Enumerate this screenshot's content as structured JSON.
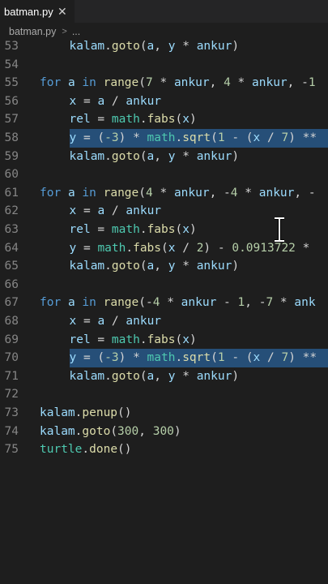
{
  "tab": {
    "label": "batman.py",
    "close_glyph": "✕"
  },
  "breadcrumb": {
    "file": "batman.py",
    "more": "..."
  },
  "colors": {
    "keyword": "#569cd6",
    "module": "#4ec9b0",
    "variable": "#9cdcfe",
    "function": "#dcdcaa",
    "number": "#b5cea8",
    "operator": "#d4d4d4",
    "selection": "#264f78",
    "line_number": "#858585"
  },
  "code": [
    {
      "n": "53",
      "indent": 1,
      "tokens": [
        [
          "kalam",
          "t"
        ],
        [
          ".",
          "o"
        ],
        [
          "goto",
          "f"
        ],
        [
          "(",
          "o"
        ],
        [
          "a",
          "t"
        ],
        [
          ", ",
          "o"
        ],
        [
          "y",
          "t"
        ],
        [
          " * ",
          "o"
        ],
        [
          "ankur",
          "t"
        ],
        [
          ")",
          "o"
        ]
      ]
    },
    {
      "n": "54",
      "indent": 0,
      "tokens": []
    },
    {
      "n": "55",
      "indent": 0,
      "tokens": [
        [
          "for",
          "k"
        ],
        [
          " ",
          "o"
        ],
        [
          "a",
          "t"
        ],
        [
          " ",
          "o"
        ],
        [
          "in",
          "k"
        ],
        [
          " ",
          "o"
        ],
        [
          "range",
          "f"
        ],
        [
          "(",
          "o"
        ],
        [
          "7",
          "n"
        ],
        [
          " * ",
          "o"
        ],
        [
          "ankur",
          "t"
        ],
        [
          ", ",
          "o"
        ],
        [
          "4",
          "n"
        ],
        [
          " * ",
          "o"
        ],
        [
          "ankur",
          "t"
        ],
        [
          ", -",
          "o"
        ],
        [
          "1",
          "n"
        ]
      ]
    },
    {
      "n": "56",
      "indent": 1,
      "tokens": [
        [
          "x",
          "t"
        ],
        [
          " = ",
          "o"
        ],
        [
          "a",
          "t"
        ],
        [
          " / ",
          "o"
        ],
        [
          "ankur",
          "t"
        ]
      ]
    },
    {
      "n": "57",
      "indent": 1,
      "tokens": [
        [
          "rel",
          "t"
        ],
        [
          " = ",
          "o"
        ],
        [
          "math",
          "g"
        ],
        [
          ".",
          "o"
        ],
        [
          "fabs",
          "f"
        ],
        [
          "(",
          "o"
        ],
        [
          "x",
          "t"
        ],
        [
          ")",
          "o"
        ]
      ]
    },
    {
      "n": "58",
      "indent": 1,
      "selected": true,
      "tokens": [
        [
          "y",
          "t"
        ],
        [
          " = (",
          "o"
        ],
        [
          "-3",
          "n"
        ],
        [
          ") * ",
          "o"
        ],
        [
          "math",
          "g"
        ],
        [
          ".",
          "o"
        ],
        [
          "sqrt",
          "f"
        ],
        [
          "(",
          "o"
        ],
        [
          "1",
          "n"
        ],
        [
          " - (",
          "o"
        ],
        [
          "x",
          "t"
        ],
        [
          " / ",
          "o"
        ],
        [
          "7",
          "n"
        ],
        [
          ") **",
          "o"
        ]
      ]
    },
    {
      "n": "59",
      "indent": 1,
      "tokens": [
        [
          "kalam",
          "t"
        ],
        [
          ".",
          "o"
        ],
        [
          "goto",
          "f"
        ],
        [
          "(",
          "o"
        ],
        [
          "a",
          "t"
        ],
        [
          ", ",
          "o"
        ],
        [
          "y",
          "t"
        ],
        [
          " * ",
          "o"
        ],
        [
          "ankur",
          "t"
        ],
        [
          ")",
          "o"
        ]
      ]
    },
    {
      "n": "60",
      "indent": 0,
      "tokens": []
    },
    {
      "n": "61",
      "indent": 0,
      "tokens": [
        [
          "for",
          "k"
        ],
        [
          " ",
          "o"
        ],
        [
          "a",
          "t"
        ],
        [
          " ",
          "o"
        ],
        [
          "in",
          "k"
        ],
        [
          " ",
          "o"
        ],
        [
          "range",
          "f"
        ],
        [
          "(",
          "o"
        ],
        [
          "4",
          "n"
        ],
        [
          " * ",
          "o"
        ],
        [
          "ankur",
          "t"
        ],
        [
          ", -",
          "o"
        ],
        [
          "4",
          "n"
        ],
        [
          " * ",
          "o"
        ],
        [
          "ankur",
          "t"
        ],
        [
          ", -",
          "o"
        ]
      ]
    },
    {
      "n": "62",
      "indent": 1,
      "tokens": [
        [
          "x",
          "t"
        ],
        [
          " = ",
          "o"
        ],
        [
          "a",
          "t"
        ],
        [
          " / ",
          "o"
        ],
        [
          "ankur",
          "t"
        ]
      ]
    },
    {
      "n": "63",
      "indent": 1,
      "tokens": [
        [
          "rel",
          "t"
        ],
        [
          " = ",
          "o"
        ],
        [
          "math",
          "g"
        ],
        [
          ".",
          "o"
        ],
        [
          "fabs",
          "f"
        ],
        [
          "(",
          "o"
        ],
        [
          "x",
          "t"
        ],
        [
          ")",
          "o"
        ]
      ]
    },
    {
      "n": "64",
      "indent": 1,
      "tokens": [
        [
          "y",
          "t"
        ],
        [
          " = ",
          "o"
        ],
        [
          "math",
          "g"
        ],
        [
          ".",
          "o"
        ],
        [
          "fabs",
          "f"
        ],
        [
          "(",
          "o"
        ],
        [
          "x",
          "t"
        ],
        [
          " / ",
          "o"
        ],
        [
          "2",
          "n"
        ],
        [
          ") - ",
          "o"
        ],
        [
          "0.0913722",
          "n"
        ],
        [
          " *",
          "o"
        ]
      ]
    },
    {
      "n": "65",
      "indent": 1,
      "tokens": [
        [
          "kalam",
          "t"
        ],
        [
          ".",
          "o"
        ],
        [
          "goto",
          "f"
        ],
        [
          "(",
          "o"
        ],
        [
          "a",
          "t"
        ],
        [
          ", ",
          "o"
        ],
        [
          "y",
          "t"
        ],
        [
          " * ",
          "o"
        ],
        [
          "ankur",
          "t"
        ],
        [
          ")",
          "o"
        ]
      ]
    },
    {
      "n": "66",
      "indent": 0,
      "tokens": []
    },
    {
      "n": "67",
      "indent": 0,
      "tokens": [
        [
          "for",
          "k"
        ],
        [
          " ",
          "o"
        ],
        [
          "a",
          "t"
        ],
        [
          " ",
          "o"
        ],
        [
          "in",
          "k"
        ],
        [
          " ",
          "o"
        ],
        [
          "range",
          "f"
        ],
        [
          "(-",
          "o"
        ],
        [
          "4",
          "n"
        ],
        [
          " * ",
          "o"
        ],
        [
          "ankur",
          "t"
        ],
        [
          " - ",
          "o"
        ],
        [
          "1",
          "n"
        ],
        [
          ", -",
          "o"
        ],
        [
          "7",
          "n"
        ],
        [
          " * ",
          "o"
        ],
        [
          "ank",
          "t"
        ]
      ]
    },
    {
      "n": "68",
      "indent": 1,
      "tokens": [
        [
          "x",
          "t"
        ],
        [
          " = ",
          "o"
        ],
        [
          "a",
          "t"
        ],
        [
          " / ",
          "o"
        ],
        [
          "ankur",
          "t"
        ]
      ]
    },
    {
      "n": "69",
      "indent": 1,
      "tokens": [
        [
          "rel",
          "t"
        ],
        [
          " = ",
          "o"
        ],
        [
          "math",
          "g"
        ],
        [
          ".",
          "o"
        ],
        [
          "fabs",
          "f"
        ],
        [
          "(",
          "o"
        ],
        [
          "x",
          "t"
        ],
        [
          ")",
          "o"
        ]
      ]
    },
    {
      "n": "70",
      "indent": 1,
      "selected": true,
      "tokens": [
        [
          "y",
          "t"
        ],
        [
          " = (",
          "o"
        ],
        [
          "-3",
          "n"
        ],
        [
          ") * ",
          "o"
        ],
        [
          "math",
          "g"
        ],
        [
          ".",
          "o"
        ],
        [
          "sqrt",
          "f"
        ],
        [
          "(",
          "o"
        ],
        [
          "1",
          "n"
        ],
        [
          " - (",
          "o"
        ],
        [
          "x",
          "t"
        ],
        [
          " / ",
          "o"
        ],
        [
          "7",
          "n"
        ],
        [
          ") **",
          "o"
        ]
      ]
    },
    {
      "n": "71",
      "indent": 1,
      "tokens": [
        [
          "kalam",
          "t"
        ],
        [
          ".",
          "o"
        ],
        [
          "goto",
          "f"
        ],
        [
          "(",
          "o"
        ],
        [
          "a",
          "t"
        ],
        [
          ", ",
          "o"
        ],
        [
          "y",
          "t"
        ],
        [
          " * ",
          "o"
        ],
        [
          "ankur",
          "t"
        ],
        [
          ")",
          "o"
        ]
      ]
    },
    {
      "n": "72",
      "indent": 0,
      "tokens": []
    },
    {
      "n": "73",
      "indent": 0,
      "tokens": [
        [
          "kalam",
          "t"
        ],
        [
          ".",
          "o"
        ],
        [
          "penup",
          "f"
        ],
        [
          "()",
          "o"
        ]
      ]
    },
    {
      "n": "74",
      "indent": 0,
      "tokens": [
        [
          "kalam",
          "t"
        ],
        [
          ".",
          "o"
        ],
        [
          "goto",
          "f"
        ],
        [
          "(",
          "o"
        ],
        [
          "300",
          "n"
        ],
        [
          ", ",
          "o"
        ],
        [
          "300",
          "n"
        ],
        [
          ")",
          "o"
        ]
      ]
    },
    {
      "n": "75",
      "indent": 0,
      "tokens": [
        [
          "turtle",
          "g"
        ],
        [
          ".",
          "o"
        ],
        [
          "done",
          "f"
        ],
        [
          "()",
          "o"
        ]
      ]
    }
  ]
}
